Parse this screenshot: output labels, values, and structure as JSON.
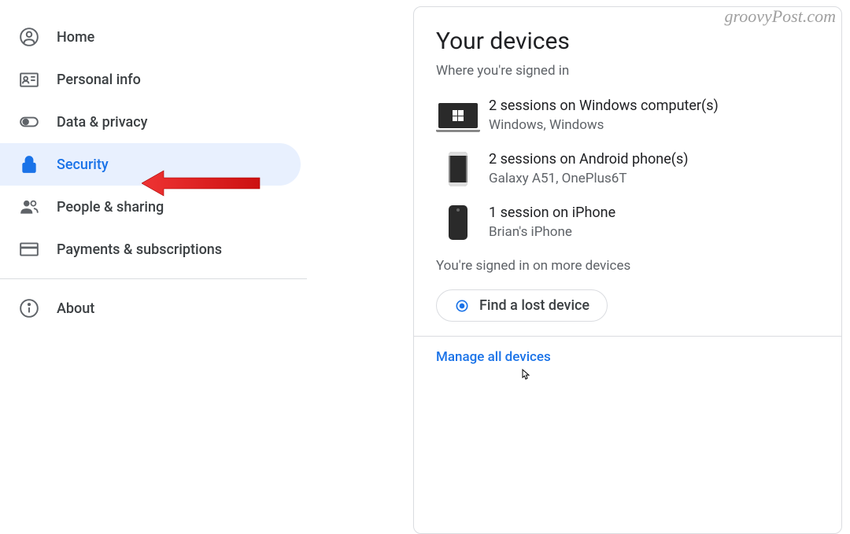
{
  "watermark": "groovyPost.com",
  "sidebar": {
    "items": [
      {
        "label": "Home"
      },
      {
        "label": "Personal info"
      },
      {
        "label": "Data & privacy"
      },
      {
        "label": "Security"
      },
      {
        "label": "People & sharing"
      },
      {
        "label": "Payments & subscriptions"
      },
      {
        "label": "About"
      }
    ]
  },
  "card": {
    "title": "Your devices",
    "subtitle": "Where you're signed in",
    "devices": [
      {
        "title": "2 sessions on Windows computer(s)",
        "detail": "Windows, Windows"
      },
      {
        "title": "2 sessions on Android phone(s)",
        "detail": "Galaxy A51, OnePlus6T"
      },
      {
        "title": "1 session on iPhone",
        "detail": "Brian's iPhone"
      }
    ],
    "more_text": "You're signed in on more devices",
    "find_button": "Find a lost device",
    "manage_link": "Manage all devices"
  }
}
